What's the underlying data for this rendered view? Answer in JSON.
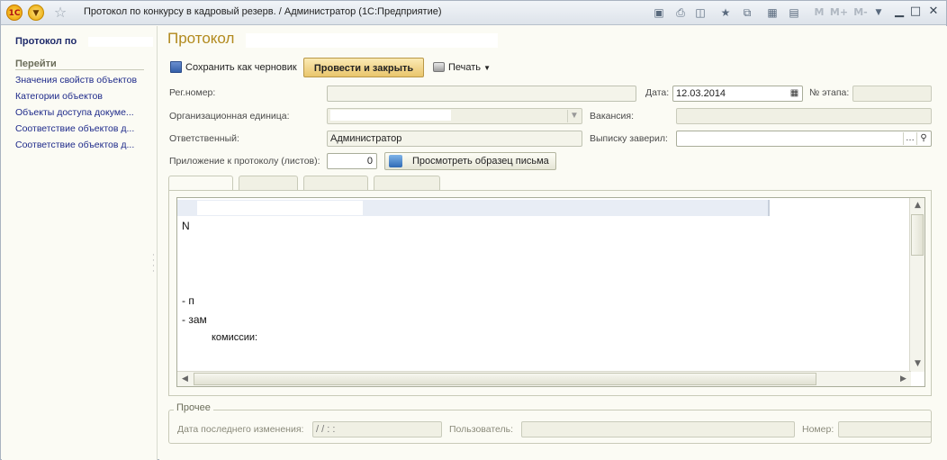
{
  "window": {
    "title": "Протокол по конкурсу в кадровый резерв. / Администратор  (1С:Предприятие)",
    "logo": "1С",
    "toolbar_m_labels": [
      "M",
      "M+",
      "M-"
    ]
  },
  "left_panel": {
    "title": "Протокол по",
    "section": "Перейти",
    "links": [
      "Значения свойств объектов",
      "Категории объектов",
      "Объекты доступа докуме...",
      "Соответствие объектов д...",
      "Соответствие объектов д..."
    ]
  },
  "form": {
    "title": "Протокол",
    "commands": {
      "save_draft": "Сохранить как черновик",
      "post_close": "Провести и закрыть",
      "print": "Печать"
    },
    "fields": {
      "reg_number_label": "Рег.номер:",
      "reg_number_value": "",
      "date_label": "Дата:",
      "date_value": "12.03.2014",
      "stage_label": "№ этапа:",
      "stage_value": "",
      "org_unit_label": "Организационная единица:",
      "org_unit_value": "",
      "vacancy_label": "Вакансия:",
      "vacancy_value": "",
      "responsible_label": "Ответственный:",
      "responsible_value": "Администратор",
      "certified_label": "Выписку заверил:",
      "certified_value": "",
      "attachment_label": "Приложение к протоколу (листов):",
      "attachment_value": "0",
      "preview_button": "Просмотреть образец письма"
    },
    "editor_lines": [
      "N",
      "- п",
      "- зам",
      "- зам",
      "комиссии:"
    ],
    "group": {
      "title": "Прочее",
      "last_modified_label": "Дата последнего изменения:",
      "last_modified_value": " / /    :  :",
      "user_label": "Пользователь:",
      "user_value": "",
      "number_label": "Номер:",
      "number_value": ""
    }
  }
}
